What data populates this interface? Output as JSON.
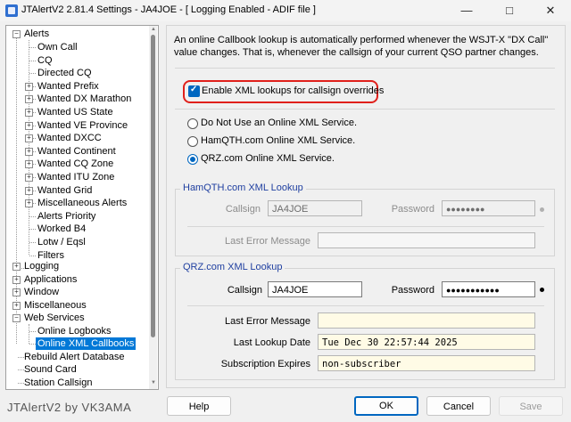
{
  "window": {
    "title": "JTAlertV2  2.81.4 Settings  -  JA4JOE  -  [ Logging Enabled - ADIF file ]",
    "minimize": "—",
    "maximize": "□",
    "close": "✕"
  },
  "tree": {
    "alerts": "Alerts",
    "alert_children": [
      "Own Call",
      "CQ",
      "Directed CQ",
      "Wanted Prefix",
      "Wanted DX Marathon",
      "Wanted US State",
      "Wanted VE Province",
      "Wanted DXCC",
      "Wanted Continent",
      "Wanted CQ Zone",
      "Wanted ITU Zone",
      "Wanted Grid",
      "Miscellaneous Alerts",
      "Alerts Priority",
      "Worked B4",
      "Lotw / Eqsl",
      "Filters"
    ],
    "logging": "Logging",
    "applications": "Applications",
    "window": "Window",
    "miscellaneous": "Miscellaneous",
    "web_services": "Web Services",
    "web_children": [
      "Online Logbooks",
      "Online XML Callbooks"
    ],
    "rebuild": "Rebuild Alert Database",
    "sound_card": "Sound Card",
    "station_callsign": "Station Callsign"
  },
  "intro_text": "An online Callbook lookup is automatically performed whenever the WSJT-X \"DX Call\" value changes. That is, whenever the callsign of your current QSO partner changes.",
  "enable_xml_label": "Enable XML lookups for callsign overrides",
  "services": {
    "none": "Do Not Use an Online XML Service.",
    "hamqth": "HamQTH.com Online XML Service.",
    "qrz": "QRZ.com Online XML Service."
  },
  "hamqth": {
    "title": "HamQTH.com XML Lookup",
    "callsign_label": "Callsign",
    "callsign_value": "JA4JOE",
    "password_label": "Password",
    "password_value": "●●●●●●●●",
    "last_error_label": "Last Error Message",
    "last_error_value": ""
  },
  "qrz": {
    "title": "QRZ.com XML Lookup",
    "callsign_label": "Callsign",
    "callsign_value": "JA4JOE",
    "password_label": "Password",
    "password_value": "●●●●●●●●●●●",
    "last_error_label": "Last Error Message",
    "last_error_value": "",
    "last_lookup_label": "Last Lookup Date",
    "last_lookup_value": "Tue Dec 30 22:57:44 2025",
    "subscription_label": "Subscription Expires",
    "subscription_value": "non-subscriber"
  },
  "footer": "JTAlertV2 by VK3AMA",
  "buttons": {
    "help": "Help",
    "ok": "OK",
    "cancel": "Cancel",
    "save": "Save"
  },
  "colors": {
    "accent": "#0067c0",
    "highlight": "#e0201b",
    "group_title": "#1f3fa0"
  }
}
